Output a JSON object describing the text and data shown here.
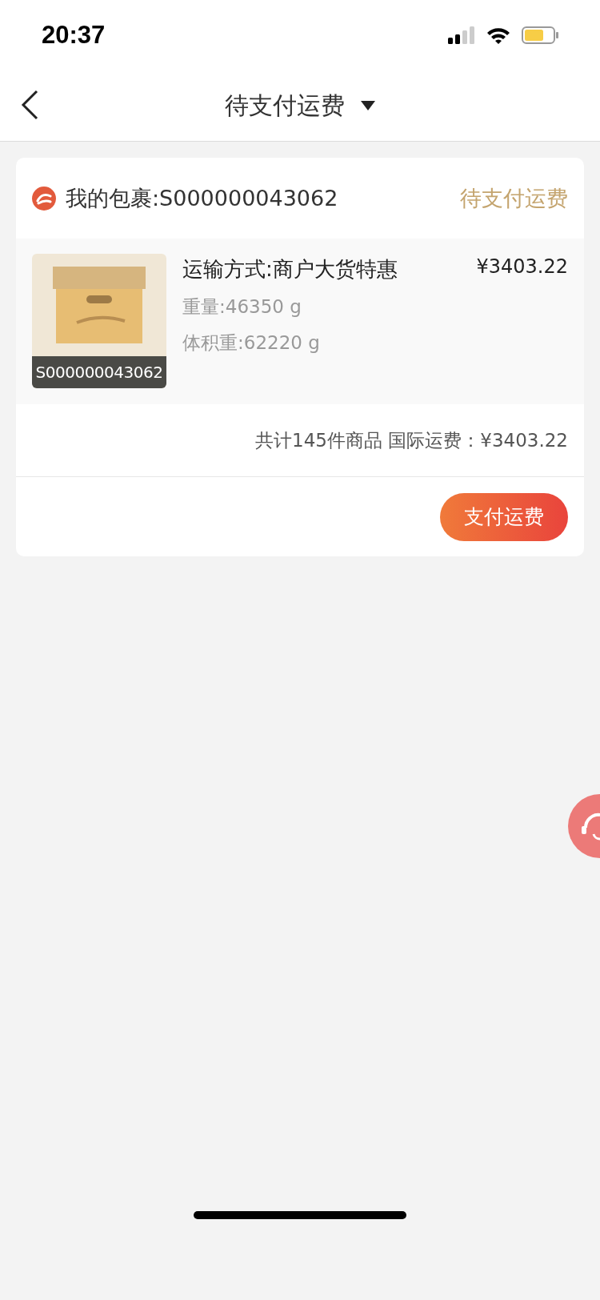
{
  "status_bar": {
    "time": "20:37"
  },
  "nav": {
    "title": "待支付运费"
  },
  "package": {
    "title": "我的包裹:S000000043062",
    "status": "待支付运费",
    "item": {
      "shipping_method": "运输方式:商户大货特惠",
      "price": "¥3403.22",
      "weight": "重量:46350 g",
      "volume_weight": "体积重:62220 g",
      "image_code": "S000000043062"
    },
    "summary": "共计145件商品 国际运费：¥3403.22",
    "pay_button": "支付运费"
  }
}
